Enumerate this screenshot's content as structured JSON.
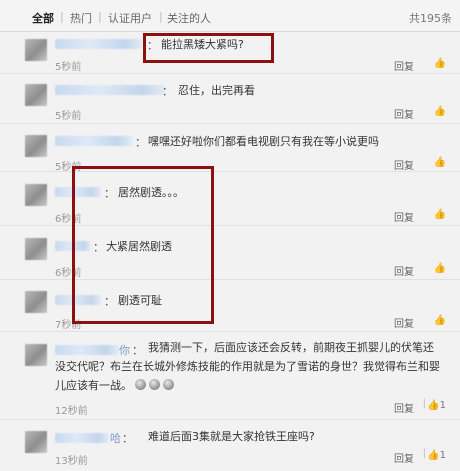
{
  "tabs": [
    "全部",
    "热门",
    "认证用户",
    "关注的人"
  ],
  "total": "共195条",
  "reply_label": "回复",
  "like_icon": "thumbs-up-icon",
  "comments": [
    {
      "text": "能拉黑矮大紧吗?",
      "time": "5秒前",
      "name_tail": ""
    },
    {
      "text": "忍住，出完再看",
      "time": "5秒前",
      "name_tail": ""
    },
    {
      "text": "嘿嘿还好啦你们都看电视剧只有我在等小说更吗",
      "time": "5秒前",
      "name_tail": ""
    },
    {
      "text": "居然剧透。。。",
      "time": "6秒前",
      "name_tail": ""
    },
    {
      "text": "大紧居然剧透",
      "time": "6秒前",
      "name_tail": ""
    },
    {
      "text": "剧透可耻",
      "time": "7秒前",
      "name_tail": ""
    },
    {
      "lines": [
        "我猜测一下，后面应该还会反转，前期夜王抓婴儿的伏笔还",
        "没交代呢？布兰在长城外修炼技能的作用就是为了雪诺的身世？我觉得布兰和婴",
        "儿应该有一战。"
      ],
      "time": "12秒前",
      "name_tail": "你",
      "like_count": "1"
    },
    {
      "text": "难道后面3集就是大家抢铁王座吗?",
      "time": "13秒前",
      "name_tail": "哈",
      "like_count": "1"
    }
  ]
}
